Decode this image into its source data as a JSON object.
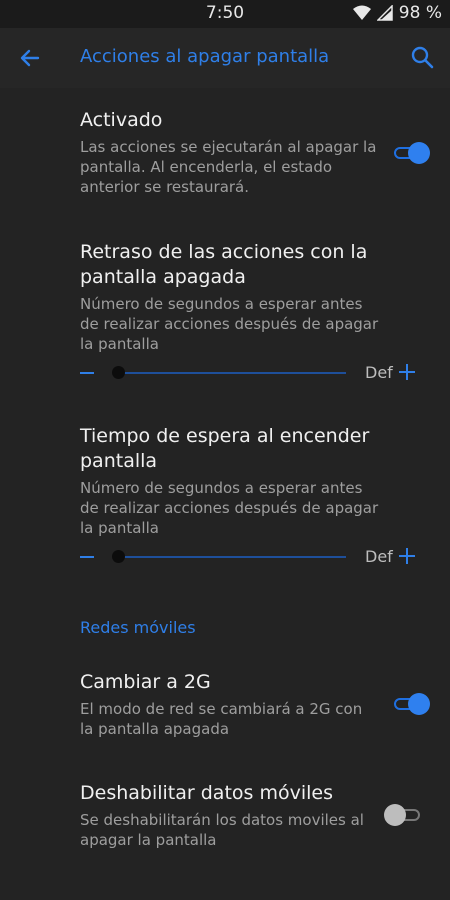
{
  "status_bar": {
    "time": "7:50",
    "battery": "98 %",
    "icons": [
      "wifi-icon",
      "signal-icon"
    ]
  },
  "app_bar": {
    "title": "Acciones al apagar pantalla",
    "back_icon": "arrow-left-icon",
    "search_icon": "search-icon"
  },
  "colors": {
    "accent": "#2f7fe8",
    "background": "#232323",
    "title_text": "#f0f0f0",
    "summary_text": "#9e9e9e"
  },
  "preferences": {
    "activated": {
      "title": "Activado",
      "summary": "Las acciones se ejecutarán al apagar la pantalla. Al encenderla, el estado anterior se restaurará.",
      "enabled": true
    },
    "delay": {
      "title": "Retraso de las acciones con la pantalla apagada",
      "summary": "Número de segundos a esperar antes de realizar acciones después de apagar la pantalla",
      "default_label": "Def",
      "value_fraction": 0
    },
    "wake_wait": {
      "title": "Tiempo de espera al encender pantalla",
      "summary": "Número de segundos a esperar antes de realizar acciones después de apagar la pantalla",
      "default_label": "Def",
      "value_fraction": 0
    }
  },
  "category": {
    "label": "Redes móviles"
  },
  "network_prefs": {
    "switch_2g": {
      "title": "Cambiar a 2G",
      "summary": "El modo de red se cambiará a 2G con la pantalla apagada",
      "enabled": true
    },
    "disable_data": {
      "title": "Deshabilitar datos móviles",
      "summary": "Se deshabilitarán los datos moviles al apagar la pantalla",
      "enabled": false
    }
  }
}
